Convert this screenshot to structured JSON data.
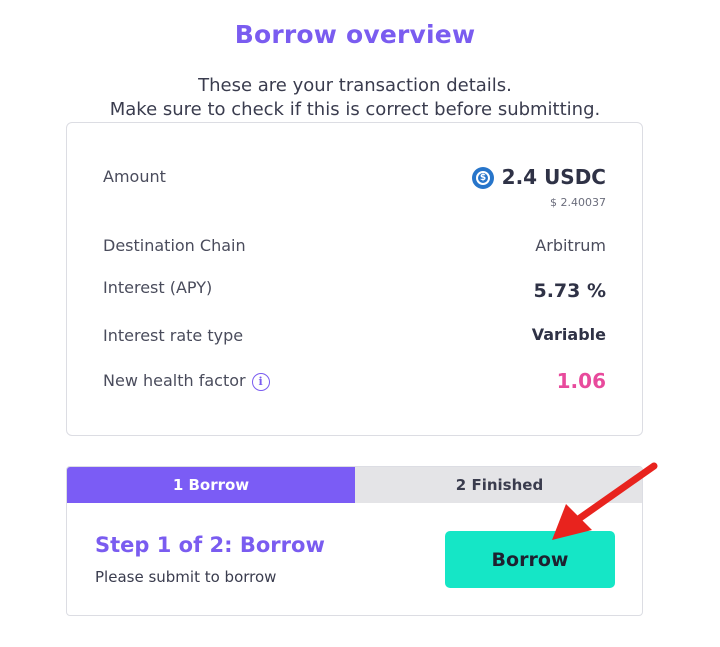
{
  "header": {
    "title": "Borrow overview",
    "subtitle_line1": "These are your transaction details.",
    "subtitle_line2": "Make sure to check if this is correct before submitting."
  },
  "details": {
    "amount_label": "Amount",
    "amount_value": "2.4 USDC",
    "amount_usd": "$ 2.40037",
    "amount_icon": "usdc-icon",
    "chain_label": "Destination Chain",
    "chain_value": "Arbitrum",
    "interest_label": "Interest (APY)",
    "interest_value": "5.73 %",
    "rate_type_label": "Interest rate type",
    "rate_type_value": "Variable",
    "health_label": "New health factor",
    "health_value": "1.06",
    "health_color": "#e84a9c"
  },
  "steps": {
    "tab1_label": "1 Borrow",
    "tab2_label": "2 Finished",
    "step_title": "Step 1 of 2: Borrow",
    "step_desc": "Please submit to borrow",
    "button_label": "Borrow"
  },
  "colors": {
    "accent": "#7a5cf0",
    "button": "#15e6c6",
    "annotation_arrow": "#e8231e"
  }
}
